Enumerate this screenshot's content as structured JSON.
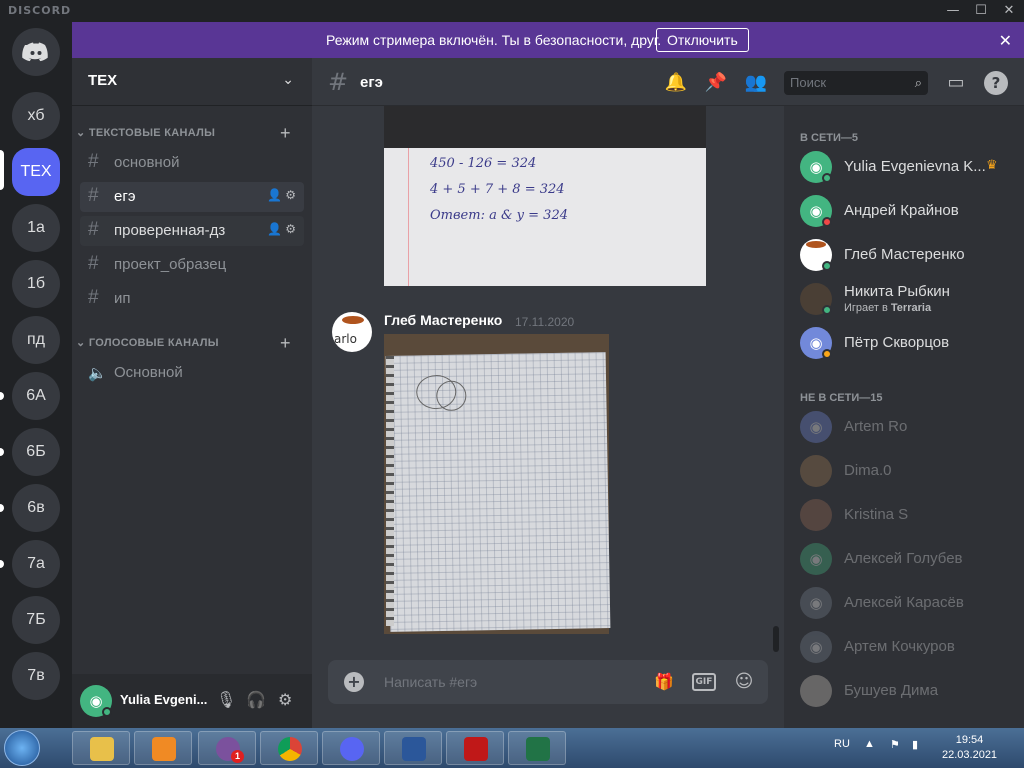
{
  "app": {
    "logo": "DISCORD",
    "minimize": "—",
    "maximize": "☐",
    "close": "✕"
  },
  "servers": [
    "хб",
    "TEX",
    "1а",
    "1б",
    "пд",
    "6А",
    "6Б",
    "6в",
    "7а",
    "7Б",
    "7в"
  ],
  "guild": {
    "name": "TEX"
  },
  "text_category": "ТЕКСТОВЫЕ КАНАЛЫ",
  "text_channels": [
    "основной",
    "егэ",
    "проверенная-дз",
    "проект_образец",
    "ип"
  ],
  "voice_category": "ГОЛОСОВЫЕ КАНАЛЫ",
  "voice_channels": [
    "Основной"
  ],
  "user": {
    "name": "Yulia Evgeni..."
  },
  "banner": {
    "text": "Режим стримера включён. Ты в безопасности, друг.",
    "button": "Отключить"
  },
  "channel": {
    "name": "егэ",
    "search_placeholder": "Поиск"
  },
  "messages": {
    "image1_lines": [
      "450 - 126 = 324",
      "4 + 5 + 7 + 8 = 324",
      "Ответ: a & y = 324"
    ],
    "author": "Глеб Мастеренко",
    "timestamp": "17.11.2020",
    "avatar_text": "arlo"
  },
  "composer": {
    "placeholder": "Написать #егэ",
    "gif": "GIF"
  },
  "members": {
    "online_header": "В СЕТИ—5",
    "online": [
      {
        "name": "Yulia Evgenievna K...",
        "status": "online",
        "color": "#43b581"
      },
      {
        "name": "Андрей Крайнов",
        "status": "dnd",
        "color": "#43b581"
      },
      {
        "name": "Глеб Мастеренко",
        "status": "online",
        "color": "#ffffff"
      },
      {
        "name": "Никита Рыбкин",
        "activity_prefix": "Играет в ",
        "activity": "Terraria",
        "status": "online",
        "color": "#4a3f35"
      },
      {
        "name": "Пётр Скворцов",
        "status": "idle",
        "color": "#7289da"
      }
    ],
    "offline_header": "НЕ В СЕТИ—15",
    "offline": [
      {
        "name": "Artem Ro",
        "color": "#7289da"
      },
      {
        "name": "Dima.0",
        "color": "#a07a50"
      },
      {
        "name": "Kristina S",
        "color": "#9a6a55"
      },
      {
        "name": "Алексей Голубев",
        "color": "#43b581"
      },
      {
        "name": "Алексей Карасёв",
        "color": "#747f8d"
      },
      {
        "name": "Артем Кочкуров",
        "color": "#747f8d"
      },
      {
        "name": "Бушуев Дима",
        "color": "#d0c8c0"
      }
    ]
  },
  "taskbar": {
    "lang": "RU",
    "time": "19:54",
    "date": "22.03.2021",
    "viber_badge": "1"
  },
  "colors": {
    "brand": "#5865f2",
    "banner": "#593695",
    "online": "#43b581",
    "dnd": "#f04747",
    "idle": "#faa61a"
  }
}
